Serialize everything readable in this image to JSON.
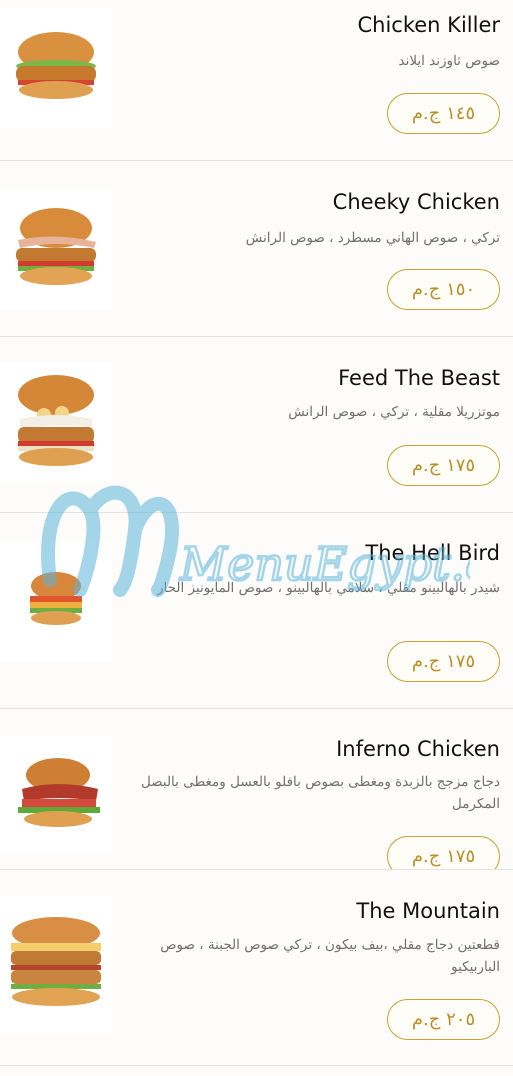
{
  "items": [
    {
      "name": "Chicken Killer",
      "desc": "صوص ثاوزند ايلاند",
      "price": "١٤٥ ج.م"
    },
    {
      "name": "Cheeky Chicken",
      "desc": "تركي ، صوص الهاني مسطرد ، صوص الرانش",
      "price": "١٥٠ ج.م"
    },
    {
      "name": "Feed The Beast",
      "desc": "موتزريلا مقلية ، تركي ، صوص الرانش",
      "price": "١٧٥ ج.م"
    },
    {
      "name": "The Hell Bird",
      "desc": "شيدر بالهالبينو مقلي ، سلامي بالهالبينو ، صوص المايونيز الحار",
      "price": "١٧٥ ج.م"
    },
    {
      "name": "Inferno Chicken",
      "desc": "دجاج مزجج بالزبدة ومغطى بصوص بافلو بالعسل ومغطى بالبصل المكرمل",
      "price": "١٧٥ ج.م"
    },
    {
      "name": "The Mountain",
      "desc": "قطعتين دجاج مقلي ،بيف بيكون ، تركي صوص الجبنة ، صوص الباربيكيو",
      "price": "٢٠٥ ج.م"
    }
  ],
  "watermark": "MenuEgypt.com"
}
